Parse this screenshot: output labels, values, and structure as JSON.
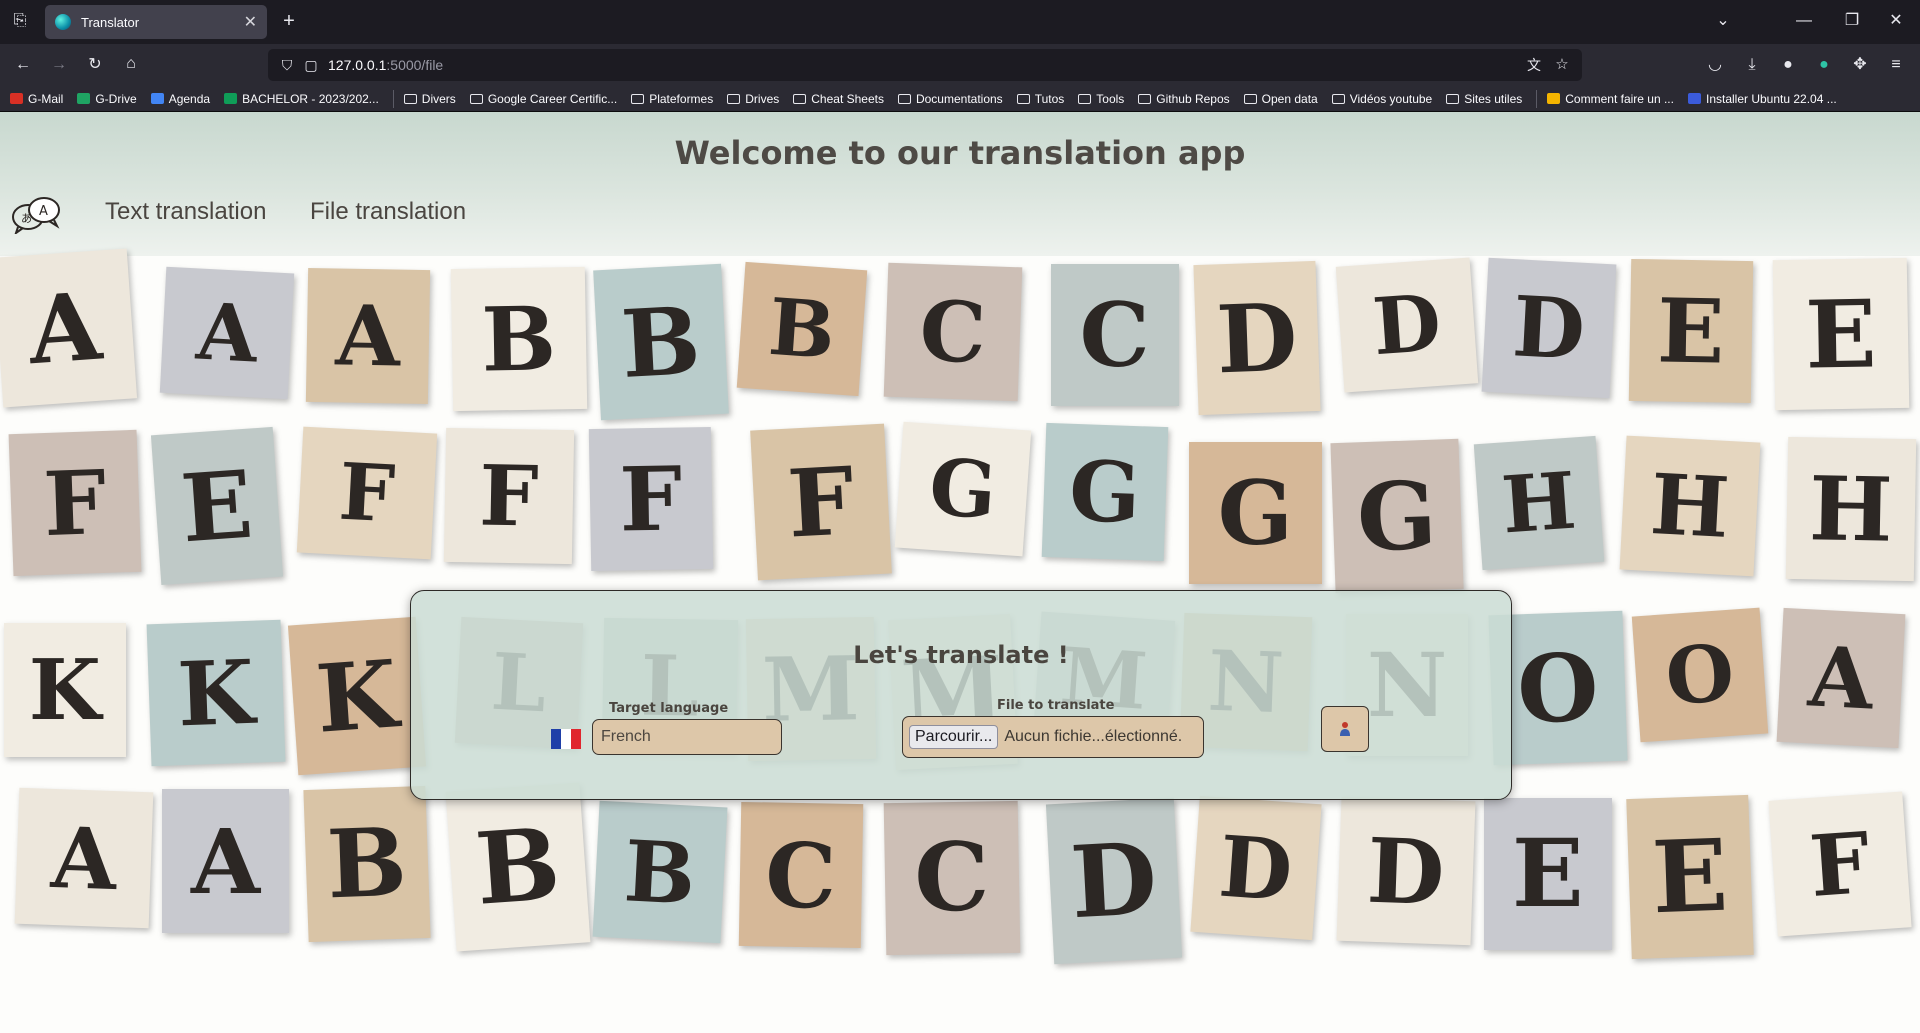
{
  "browser": {
    "tab_title": "Translator",
    "url_host": "127.0.0.1",
    "url_rest": ":5000/file",
    "new_tab": "+",
    "tab_close": "✕"
  },
  "bookmarks": [
    {
      "label": "G-Mail",
      "icon": "gmail-icon",
      "color": "#d93025"
    },
    {
      "label": "G-Drive",
      "icon": "drive-icon",
      "color": "#1fa463"
    },
    {
      "label": "Agenda",
      "icon": "calendar-icon",
      "color": "#4285f4"
    },
    {
      "label": "BACHELOR - 2023/202...",
      "icon": "sheets-icon",
      "color": "#0f9d58"
    },
    {
      "label": "Divers",
      "icon": "folder-icon"
    },
    {
      "label": "Google Career Certific...",
      "icon": "folder-icon"
    },
    {
      "label": "Plateformes",
      "icon": "folder-icon"
    },
    {
      "label": "Drives",
      "icon": "folder-icon"
    },
    {
      "label": "Cheat Sheets",
      "icon": "folder-icon"
    },
    {
      "label": "Documentations",
      "icon": "folder-icon"
    },
    {
      "label": "Tutos",
      "icon": "folder-icon"
    },
    {
      "label": "Tools",
      "icon": "folder-icon"
    },
    {
      "label": "Github Repos",
      "icon": "folder-icon"
    },
    {
      "label": "Open data",
      "icon": "folder-icon"
    },
    {
      "label": "Vidéos youtube",
      "icon": "folder-icon"
    },
    {
      "label": "Sites utiles",
      "icon": "folder-icon"
    },
    {
      "label": "Comment faire un ...",
      "icon": "page-icon",
      "color": "#f4b400"
    },
    {
      "label": "Installer Ubuntu 22.04 ...",
      "icon": "page-icon",
      "color": "#3b5bdb"
    }
  ],
  "header": {
    "title": "Welcome to our translation app",
    "nav": [
      "Text translation",
      "File translation"
    ]
  },
  "collage_letters": [
    "A",
    "A",
    "A",
    "B",
    "B",
    "B",
    "C",
    "C",
    "D",
    "D",
    "D",
    "E",
    "E",
    "F",
    "E",
    "F",
    "F",
    "F",
    "F",
    "G",
    "G",
    "G",
    "G",
    "H",
    "H",
    "H",
    "K",
    "K",
    "K",
    "L",
    "L",
    "M",
    "M",
    "M",
    "N",
    "N",
    "O",
    "O"
  ],
  "form": {
    "heading": "Let's translate !",
    "target_label": "Target language",
    "language_value": "French",
    "file_label": "File to translate",
    "browse_button": "Parcourir...",
    "file_status": "Aucun fichie...électionné.",
    "submit_icon": "upload-person-icon"
  },
  "colors": {
    "header_bg": "#cbdcd2",
    "field_bg": "#ddc7a9",
    "text_dark": "#4a453f"
  }
}
